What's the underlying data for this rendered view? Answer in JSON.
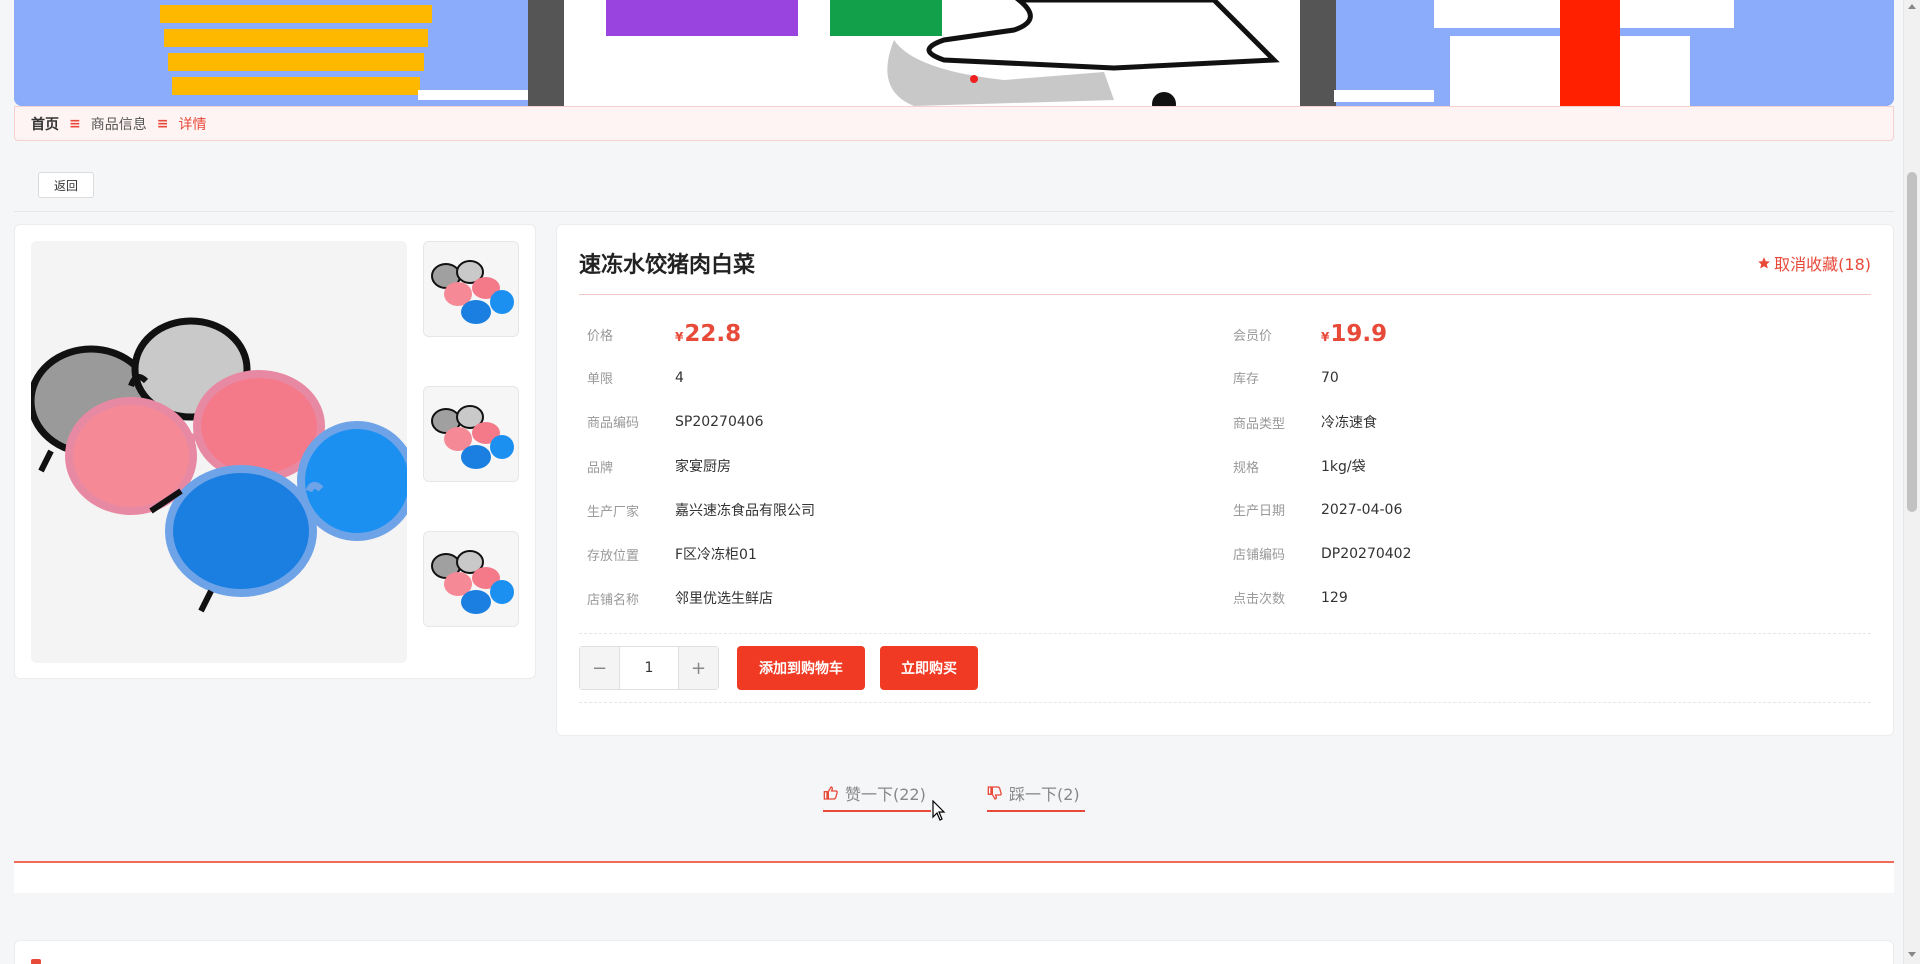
{
  "breadcrumb": {
    "home": "首页",
    "sep": "≡",
    "middle": "商品信息",
    "current": "详情"
  },
  "back_label": "返回",
  "product": {
    "name": "速冻水饺猪肉白菜",
    "favorite_label": "取消收藏(18)",
    "currency": "¥",
    "fields": {
      "price_label": "价格",
      "price": "22.8",
      "member_price_label": "会员价",
      "member_price": "19.9",
      "limit_label": "单限",
      "limit": "4",
      "stock_label": "库存",
      "stock": "70",
      "code_label": "商品编码",
      "code": "SP20270406",
      "type_label": "商品类型",
      "type": "冷冻速食",
      "brand_label": "品牌",
      "brand": "家宴厨房",
      "spec_label": "规格",
      "spec": "1kg/袋",
      "maker_label": "生产厂家",
      "maker": "嘉兴速冻食品有限公司",
      "date_label": "生产日期",
      "date": "2027-04-06",
      "location_label": "存放位置",
      "location": "F区冷冻柜01",
      "store_code_label": "店铺编码",
      "store_code": "DP20270402",
      "store_name_label": "店铺名称",
      "store_name": "邻里优选生鲜店",
      "clicks_label": "点击次数",
      "clicks": "129"
    },
    "quantity": "1",
    "qty_minus": "−",
    "qty_plus": "+",
    "add_cart_label": "添加到购物车",
    "buy_now_label": "立即购买"
  },
  "votes": {
    "like": "赞一下(22)",
    "dislike": "踩一下(2)"
  },
  "colors": {
    "accent": "#f03a24",
    "banner_bg": "#8aacfb"
  }
}
